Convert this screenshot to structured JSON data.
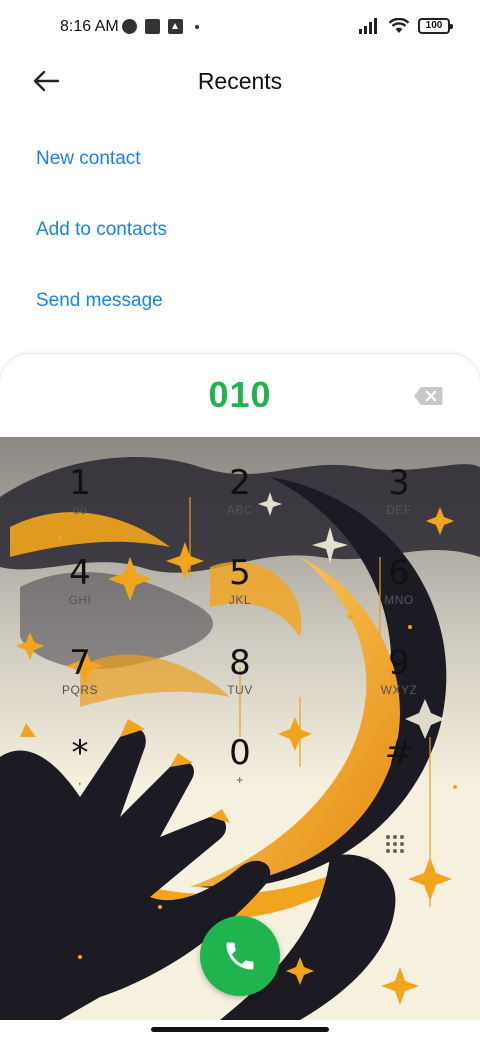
{
  "status_bar": {
    "time": "8:16 AM",
    "battery": "100",
    "icons": [
      "app-circle-icon",
      "square-icon",
      "upload-icon",
      "dot-icon",
      "signal-icon",
      "wifi-icon",
      "battery-icon"
    ]
  },
  "header": {
    "title": "Recents",
    "back_icon": "back-arrow-icon"
  },
  "actions": [
    {
      "label": "New contact"
    },
    {
      "label": "Add to contacts"
    },
    {
      "label": "Send message"
    }
  ],
  "dialer": {
    "number": "010",
    "backspace_icon": "backspace-icon",
    "call_icon": "phone-icon",
    "keys": [
      {
        "digit": "1",
        "letters": "oo"
      },
      {
        "digit": "2",
        "letters": "ABC"
      },
      {
        "digit": "3",
        "letters": "DEF"
      },
      {
        "digit": "4",
        "letters": "GHI"
      },
      {
        "digit": "5",
        "letters": "JKL"
      },
      {
        "digit": "6",
        "letters": "MNO"
      },
      {
        "digit": "7",
        "letters": "PQRS"
      },
      {
        "digit": "8",
        "letters": "TUV"
      },
      {
        "digit": "9",
        "letters": "WXYZ"
      },
      {
        "digit": "*",
        "letters": ","
      },
      {
        "digit": "0",
        "letters": "+"
      },
      {
        "digit": "#",
        "letters": ""
      }
    ]
  },
  "colors": {
    "accent_blue": "#1a82e2",
    "number_green": "#1fb44e",
    "call_green": "#1fb44e",
    "wallpaper_gold": "#f2a51c",
    "wallpaper_dark": "#1c1a22",
    "wallpaper_cream": "#f6f0de"
  }
}
